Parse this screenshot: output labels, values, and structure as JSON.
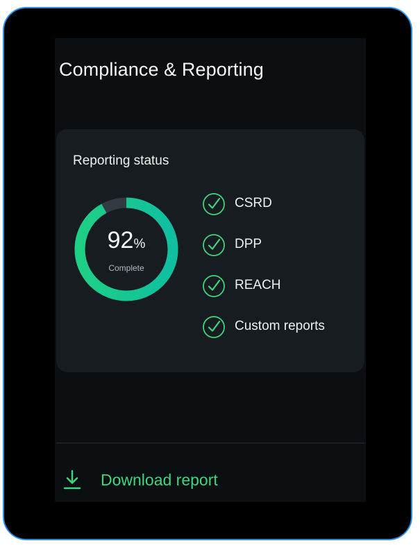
{
  "header": {
    "title": "Compliance & Reporting"
  },
  "reporting_status": {
    "title": "Reporting status",
    "progress": {
      "value": "92",
      "unit": "%",
      "label": "Complete",
      "fraction": 0.92
    },
    "items": [
      {
        "label": "CSRD",
        "icon": "check-circle-icon",
        "status": "done"
      },
      {
        "label": "DPP",
        "icon": "check-circle-icon",
        "status": "done"
      },
      {
        "label": "REACH",
        "icon": "check-circle-icon",
        "status": "done"
      },
      {
        "label": "Custom reports",
        "icon": "check-circle-icon",
        "status": "done"
      }
    ]
  },
  "actions": {
    "download_label": "Download report",
    "download_icon": "download-icon"
  },
  "colors": {
    "accent_green": "#3dd67d",
    "ring_teal": "#12c79b",
    "ring_track": "#323b43",
    "device_frame": "#2b8fe8"
  }
}
